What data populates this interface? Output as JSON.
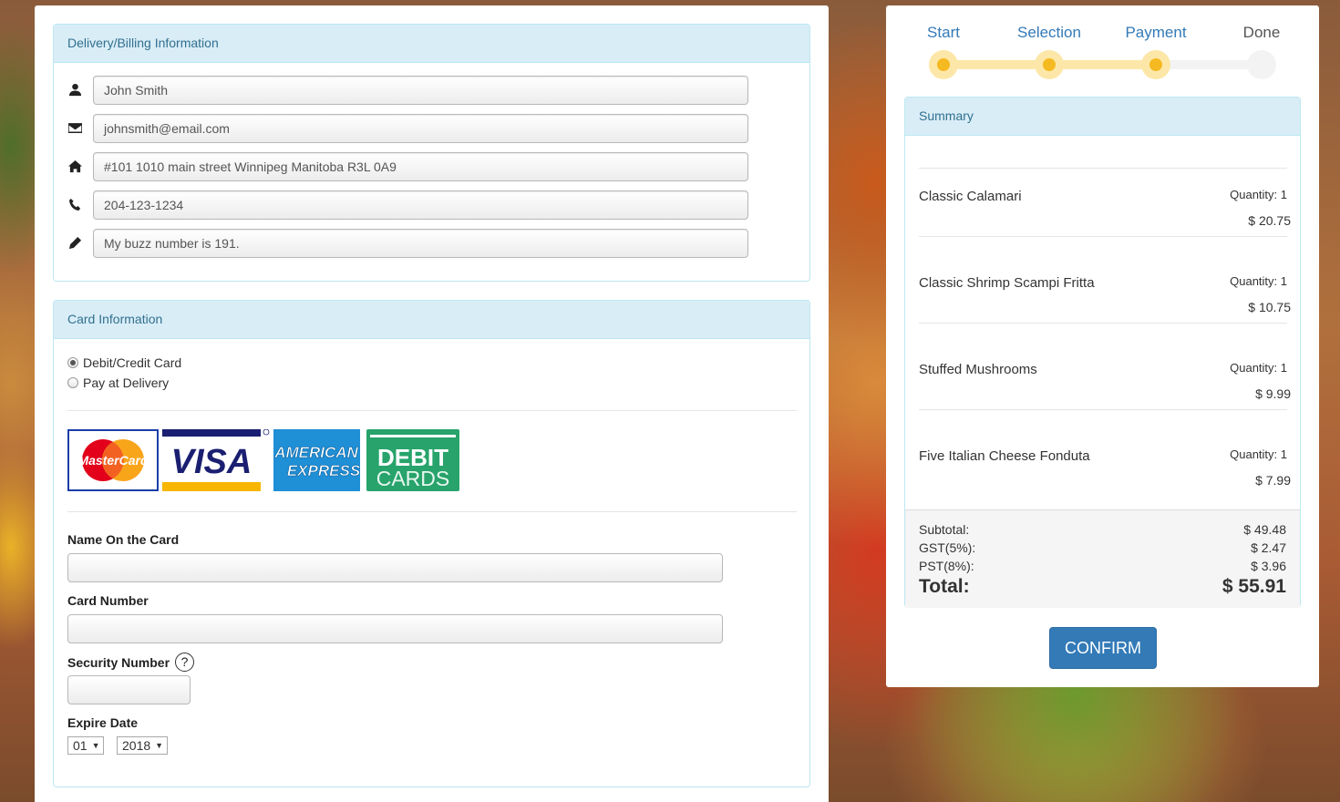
{
  "delivery": {
    "heading": "Delivery/Billing Information",
    "fields": [
      {
        "icon": "user-icon",
        "value": "John Smith"
      },
      {
        "icon": "envelope-icon",
        "value": "johnsmith@email.com"
      },
      {
        "icon": "home-icon",
        "value": "#101 1010 main street Winnipeg Manitoba R3L 0A9"
      },
      {
        "icon": "phone-icon",
        "value": "204-123-1234"
      },
      {
        "icon": "pencil-icon",
        "value": "My buzz number is 191."
      }
    ]
  },
  "card": {
    "heading": "Card Information",
    "payment_options": [
      {
        "label": "Debit/Credit Card",
        "selected": true
      },
      {
        "label": "Pay at Delivery",
        "selected": false
      }
    ],
    "logos": {
      "mastercard": "MasterCard",
      "visa": "VISA",
      "amex_line1": "AMERICAN",
      "amex_line2": "EXPRESS",
      "debit_line1": "DEBIT",
      "debit_line2": "CARDS"
    },
    "name_label": "Name On the Card",
    "number_label": "Card Number",
    "security_label": "Security Number",
    "security_help": "?",
    "expire_label": "Expire Date",
    "expire_month": "01",
    "expire_year": "2018"
  },
  "steps": [
    {
      "label": "Start",
      "state": "done"
    },
    {
      "label": "Selection",
      "state": "done"
    },
    {
      "label": "Payment",
      "state": "current"
    },
    {
      "label": "Done",
      "state": "todo"
    }
  ],
  "summary": {
    "heading": "Summary",
    "items": [
      {
        "name": "Classic Calamari",
        "quantity": "Quantity: 1",
        "price": "$ 20.75"
      },
      {
        "name": "Classic Shrimp Scampi Fritta",
        "quantity": "Quantity: 1",
        "price": "$ 10.75"
      },
      {
        "name": "Stuffed Mushrooms",
        "quantity": "Quantity: 1",
        "price": "$ 9.99"
      },
      {
        "name": "Five Italian Cheese Fonduta",
        "quantity": "Quantity: 1",
        "price": "$ 7.99"
      }
    ],
    "subtotal_label": "Subtotal:",
    "subtotal": "$ 49.48",
    "gst_label": "GST(5%):",
    "gst": "$ 2.47",
    "pst_label": "PST(8%):",
    "pst": "$ 3.96",
    "total_label": "Total:",
    "total": "$ 55.91"
  },
  "confirm_label": "CONFIRM",
  "colors": {
    "panel_heading_bg": "#d9edf7",
    "panel_heading_text": "#31708f",
    "primary": "#337ab7",
    "step_active": "#f5b921",
    "step_track": "#fde7a8"
  }
}
